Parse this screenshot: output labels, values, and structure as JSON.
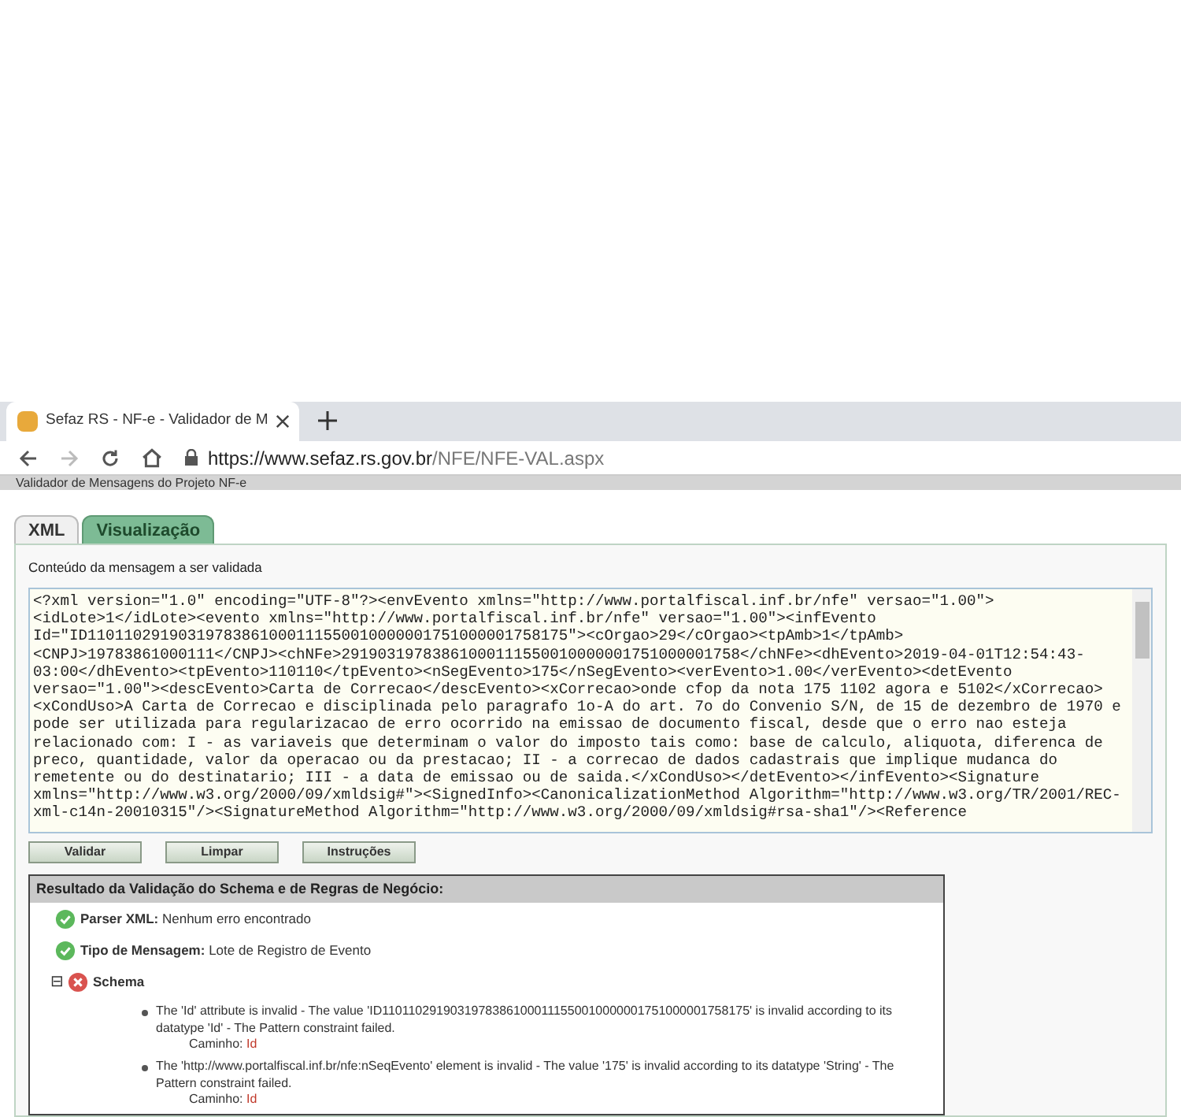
{
  "browser": {
    "tab_title": "Sefaz RS - NF-e - Validador de M",
    "url_host": "https://www.sefaz.rs.gov.br",
    "url_path": "/NFE/NFE-VAL.aspx"
  },
  "page_header": "Validador de Mensagens do Projeto NF-e",
  "tabs": [
    {
      "label": "XML",
      "selected": false
    },
    {
      "label": "Visualização",
      "selected": true
    }
  ],
  "message_label": "Conteúdo da mensagem a ser validada",
  "xml_lines": [
    "<?xml version=\"1.0\" encoding=\"UTF-8\"?><envEvento xmlns=\"http://www.portalfiscal.inf.br/nfe\" versao=\"1.00\">",
    "<idLote>1</idLote><evento xmlns=\"http://www.portalfiscal.inf.br/nfe\" versao=\"1.00\"><infEvento",
    "Id=\"ID11011029190319783861000111550010000001751000001758175\"><cOrgao>29</cOrgao><tpAmb>1</tpAmb>",
    "<CNPJ>19783861000111</CNPJ><chNFe>29190319783861000111550010000001751000001758</chNFe><dhEvento>2019-04-01T12:54:43-",
    "03:00</dhEvento><tpEvento>110110</tpEvento><nSegEvento>175</nSegEvento><verEvento>1.00</verEvento><detEvento",
    "versao=\"1.00\"><descEvento>Carta de Correcao</descEvento><xCorrecao>onde cfop da nota 175 1102 agora e 5102</xCorrecao>",
    "<xCondUso>A Carta de Correcao e disciplinada pelo paragrafo 1o-A do art. 7o do Convenio S/N, de 15 de dezembro de 1970 e",
    "pode ser utilizada para regularizacao de erro ocorrido na emissao de documento fiscal, desde que o erro nao esteja",
    "relacionado com: I - as variaveis que determinam o valor do imposto tais como: base de calculo, aliquota, diferenca de",
    "preco, quantidade, valor da operacao ou da prestacao; II - a correcao de dados cadastrais que implique mudanca do",
    "remetente ou do destinatario; III - a data de emissao ou de saida.</xCondUso></detEvento></infEvento><Signature",
    "xmlns=\"http://www.w3.org/2000/09/xmldsig#\"><SignedInfo><CanonicalizationMethod Algorithm=\"http://www.w3.org/TR/2001/REC-",
    "xml-c14n-20010315\"/><SignatureMethod Algorithm=\"http://www.w3.org/2000/09/xmldsig#rsa-sha1\"/><Reference"
  ],
  "buttons": [
    "Validar",
    "Limpar",
    "Instruções"
  ],
  "results": {
    "title": "Resultado da Validação do Schema e de Regras de Negócio:",
    "items": [
      {
        "kind": "ok",
        "label": "Parser XML:",
        "value": "Nenhum erro encontrado"
      },
      {
        "kind": "ok",
        "label": "Tipo de Mensagem:",
        "value": "Lote de Registro de Evento"
      }
    ],
    "schema": {
      "kind": "error",
      "toggle": "⊟",
      "expanded": true,
      "label": "Schema",
      "errors": [
        {
          "message": "The 'Id' attribute is invalid - The value 'ID11011029190319783861000111550010000001751000001758175' is invalid according to its datatype 'Id' - The Pattern constraint failed.",
          "path_label": "Caminho:",
          "path": "Id"
        },
        {
          "message": "The 'http://www.portalfiscal.inf.br/nfe:nSeqEvento' element is invalid - The value '175' is invalid according to its datatype 'String' - The Pattern constraint failed.",
          "path_label": "Caminho:",
          "path": "Id"
        }
      ]
    }
  }
}
